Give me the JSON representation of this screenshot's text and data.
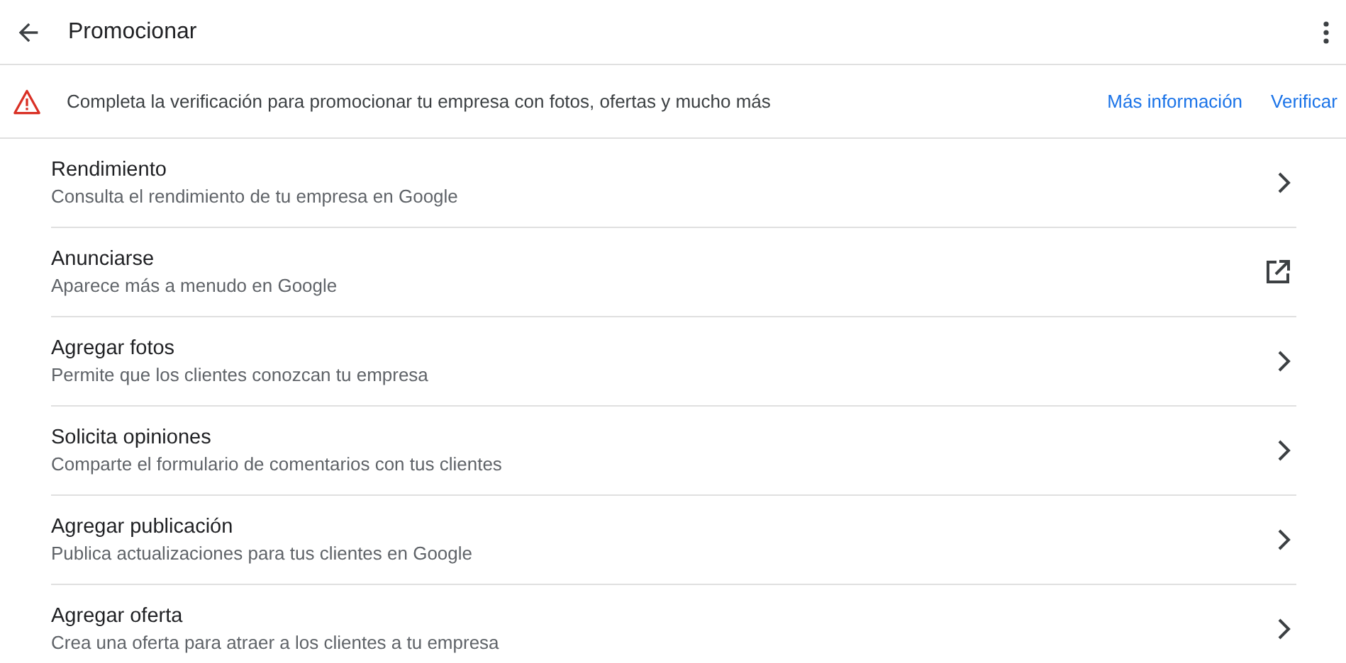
{
  "header": {
    "title": "Promocionar"
  },
  "banner": {
    "message": "Completa la verificación para promocionar tu empresa con fotos, ofertas y mucho más",
    "links": [
      "Más información",
      "Verificar"
    ]
  },
  "items": [
    {
      "title": "Rendimiento",
      "subtitle": "Consulta el rendimiento de tu empresa en Google",
      "kind": "chevron"
    },
    {
      "title": "Anunciarse",
      "subtitle": "Aparece más a menudo en Google",
      "kind": "external"
    },
    {
      "title": "Agregar fotos",
      "subtitle": "Permite que los clientes conozcan tu empresa",
      "kind": "chevron"
    },
    {
      "title": "Solicita opiniones",
      "subtitle": "Comparte el formulario de comentarios con tus clientes",
      "kind": "chevron"
    },
    {
      "title": "Agregar publicación",
      "subtitle": "Publica actualizaciones para tus clientes en Google",
      "kind": "chevron"
    },
    {
      "title": "Agregar oferta",
      "subtitle": "Crea una oferta para atraer a los clientes a tu empresa",
      "kind": "chevron"
    }
  ]
}
